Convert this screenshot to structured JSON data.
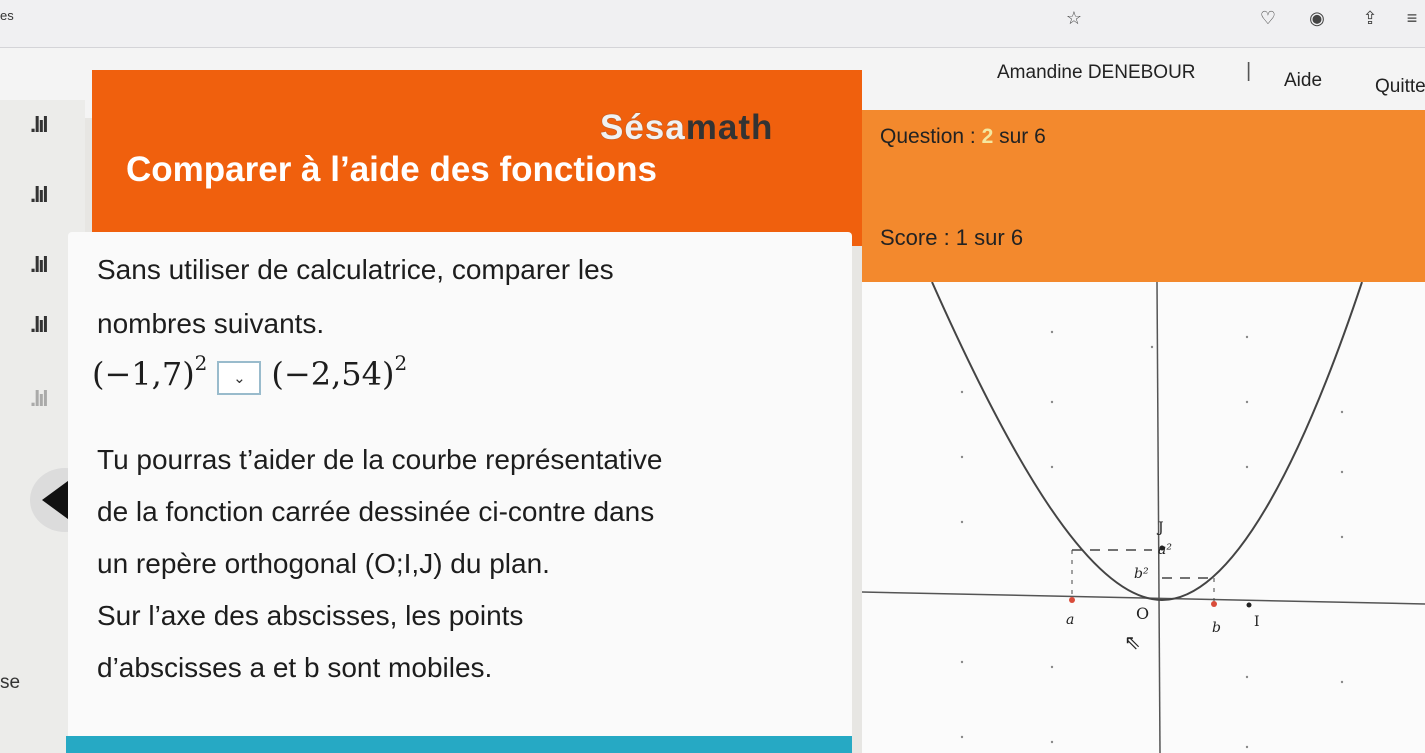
{
  "browser": {
    "tab_fragment": "es",
    "icons": [
      "star-icon",
      "pocket-icon",
      "account-icon",
      "share-icon",
      "menu-icon"
    ]
  },
  "header": {
    "user_name": "Amandine DENEBOUR",
    "separator": "|",
    "help_label": "Aide",
    "quit_label": "Quitte"
  },
  "brand": {
    "logo_part1": "Sésa",
    "logo_part2": "math"
  },
  "exercise": {
    "title": "Comparer à l’aide des fonctions",
    "question_label": "Question :",
    "question_num": "2",
    "question_total": "sur 6",
    "score_text": "Score : 1 sur 6",
    "instruction_line1": "Sans utiliser de calculatrice, comparer les",
    "instruction_line2": "nombres suivants.",
    "expr_left": "(−1,7)",
    "expr_left_exp": "2",
    "select_glyph": "⌄",
    "expr_right": "(−2,54)",
    "expr_right_exp": "2",
    "help_line1": "Tu pourras t’aider de la courbe représentative",
    "help_line2": "de la fonction carrée dessinée ci-contre dans",
    "help_line3": "un repère orthogonal (O;I,J) du plan.",
    "help_line4": "Sur l’axe des abscisses, les points",
    "help_line5": "d’abscisses a et b sont mobiles."
  },
  "sidebar": {
    "icon_glyph": ".lıl",
    "bottom_text": "se"
  },
  "graph": {
    "label_J": "J",
    "label_a2": "a²",
    "label_b2": "b²",
    "label_a": "a",
    "label_O": "O",
    "label_b": "b",
    "label_I": "I"
  },
  "colors": {
    "orange_dark": "#f0600d",
    "orange_light": "#f3892d",
    "teal": "#26a9c4"
  }
}
